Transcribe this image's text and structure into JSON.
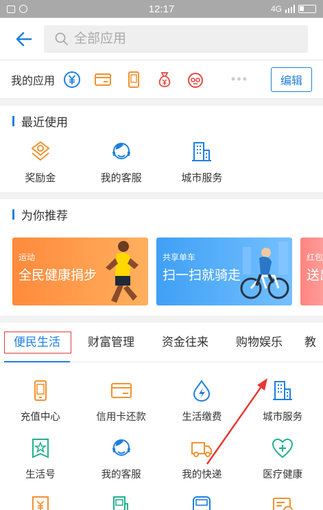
{
  "status": {
    "time": "12:17",
    "network": "4G"
  },
  "header": {
    "search_placeholder": "全部应用"
  },
  "my_apps": {
    "label": "我的应用",
    "edit_label": "编辑",
    "icons": [
      "yuan-circle-icon",
      "card-icon",
      "phone-icon",
      "money-bag-icon",
      "face-icon"
    ]
  },
  "recent": {
    "title": "最近使用",
    "items": [
      {
        "label": "奖励金",
        "icon": "reward-icon"
      },
      {
        "label": "我的客服",
        "icon": "customer-service-icon"
      },
      {
        "label": "城市服务",
        "icon": "city-building-icon"
      }
    ]
  },
  "recommend": {
    "title": "为你推荐",
    "banners": [
      {
        "tag": "运动",
        "title": "全民健康捐步"
      },
      {
        "tag": "共享单车",
        "title": "扫一扫就骑走"
      },
      {
        "tag": "红包",
        "title": "送出"
      }
    ]
  },
  "tabs": [
    "便民生活",
    "财富管理",
    "资金往来",
    "购物娱乐",
    "教"
  ],
  "grid": [
    {
      "label": "充值中心",
      "icon": "phone-recharge-icon"
    },
    {
      "label": "信用卡还款",
      "icon": "credit-card-icon"
    },
    {
      "label": "生活缴费",
      "icon": "utility-bolt-icon"
    },
    {
      "label": "城市服务",
      "icon": "city-building-icon"
    },
    {
      "label": "生活号",
      "icon": "star-badge-icon"
    },
    {
      "label": "我的客服",
      "icon": "customer-service-icon"
    },
    {
      "label": "我的快递",
      "icon": "delivery-truck-icon"
    },
    {
      "label": "医疗健康",
      "icon": "medical-heart-icon"
    }
  ],
  "colors": {
    "accent": "#1e7fe0",
    "orange": "#f29130",
    "teal": "#23b08f",
    "red": "#e8463f"
  }
}
